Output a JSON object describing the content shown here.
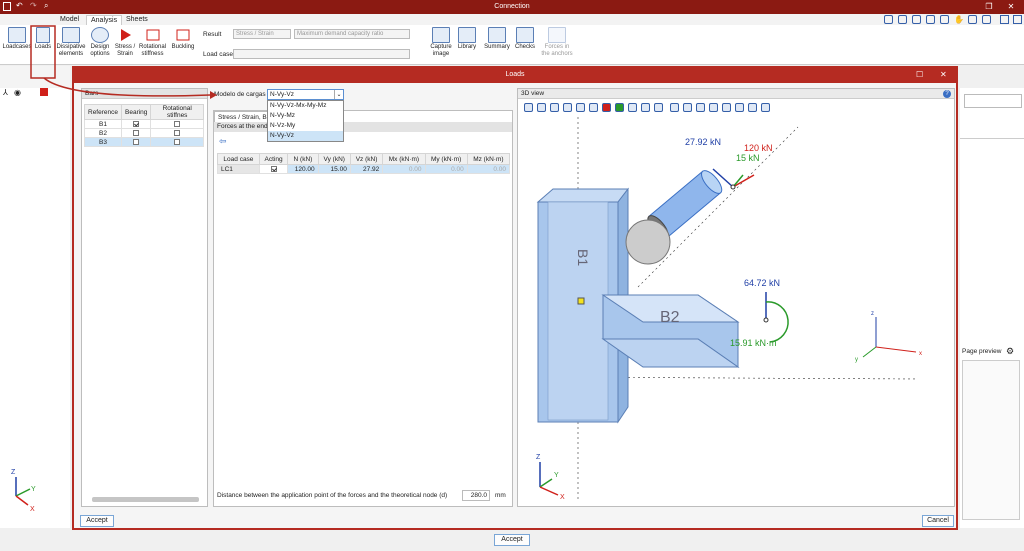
{
  "app": {
    "title": "Connection"
  },
  "menu": {
    "items": [
      "Model",
      "Analysis",
      "Sheets"
    ]
  },
  "ribbon": {
    "buttons": [
      {
        "label": "Loadcases"
      },
      {
        "label": "Loads"
      },
      {
        "label": "Dissipative elements"
      },
      {
        "label": "Design options"
      },
      {
        "label": "Stress / Strain"
      },
      {
        "label": "Rotational stiffness"
      },
      {
        "label": "Buckling"
      },
      {
        "label": "Capture image"
      },
      {
        "label": "Library"
      },
      {
        "label": "Summary"
      },
      {
        "label": "Checks"
      },
      {
        "label": "Forces in the anchors"
      }
    ],
    "result_label": "Result",
    "result_value": "Stress / Strain",
    "result_metric": "Maximum demand capacity ratio",
    "loadcase_label": "Load case"
  },
  "dialog": {
    "title": "Loads",
    "bars_panel": {
      "title": "Bars",
      "columns": [
        "Reference",
        "Bearing",
        "Rotational stiffnes"
      ],
      "rows": [
        {
          "ref": "B1",
          "bearing": true,
          "rot": false
        },
        {
          "ref": "B2",
          "bearing": false,
          "rot": false
        },
        {
          "ref": "B3",
          "bearing": false,
          "rot": false
        }
      ]
    },
    "load_model_label": "Modelo de cargas",
    "load_model_value": "N-Vy-Vz",
    "load_model_options": [
      "N-Vy-Vz-Mx-My-Mz",
      "N-Vy-Mz",
      "N-Vz-My",
      "N-Vy-Vz"
    ],
    "tab_label": "Stress / Strain, Bu",
    "forces_title": "Forces at the end o",
    "table": {
      "columns": [
        "Load case",
        "Acting",
        "N (kN)",
        "Vy (kN)",
        "Vz (kN)",
        "Mx (kN·m)",
        "My (kN·m)",
        "Mz (kN·m)"
      ],
      "rows": [
        {
          "lc": "LC1",
          "acting": true,
          "n": "120.00",
          "vy": "15.00",
          "vz": "27.92",
          "mx": "0.00",
          "my": "0.00",
          "mz": "0.00"
        }
      ]
    },
    "distance_label": "Distance between the application point of the forces and the theoretical node (d)",
    "distance_value": "280.0",
    "distance_unit": "mm",
    "view_title": "3D view",
    "view_labels": {
      "f1": "27.92 kN",
      "f2": "120 kN",
      "f3": "15 kN",
      "f4": "64.72 kN",
      "f5": "15.91 kN·m",
      "bar_b1": "B1",
      "bar_b2": "B2",
      "axis_x": "x",
      "axis_y": "y",
      "axis_z": "z",
      "big_x": "X",
      "big_y": "Y",
      "big_z": "Z"
    },
    "accept": "Accept",
    "cancel": "Cancel"
  },
  "right_pane": {
    "page_preview": "Page preview"
  },
  "footer": {
    "accept": "Accept"
  },
  "colors": {
    "accent": "#b52b22",
    "title": "#8b1a12"
  }
}
